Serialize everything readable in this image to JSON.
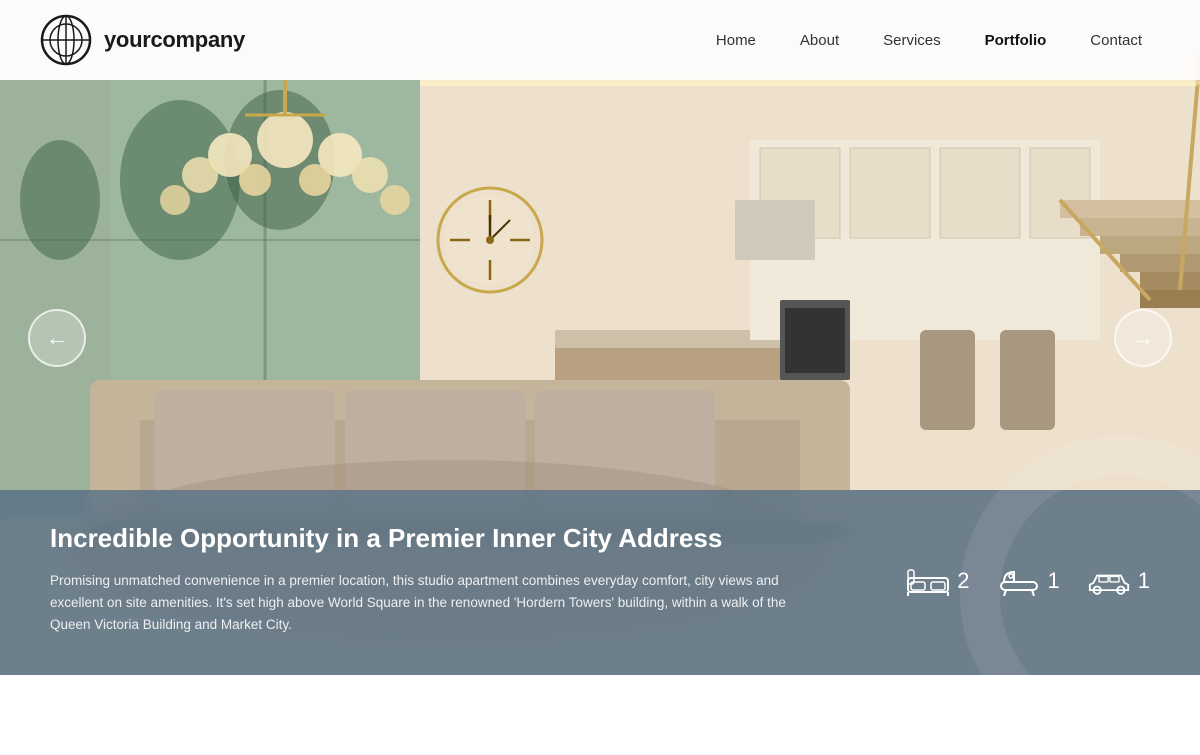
{
  "brand": {
    "name": "yourcompany"
  },
  "nav": {
    "items": [
      {
        "label": "Home",
        "active": false
      },
      {
        "label": "About",
        "active": false
      },
      {
        "label": "Services",
        "active": false
      },
      {
        "label": "Portfolio",
        "active": true
      },
      {
        "label": "Contact",
        "active": false
      }
    ]
  },
  "carousel": {
    "prev_arrow": "←",
    "next_arrow": "→"
  },
  "listing": {
    "title": "Incredible Opportunity in a Premier Inner City Address",
    "description": "Promising unmatched convenience in a premier location, this studio apartment combines everyday comfort, city views and excellent on site amenities. It's set high above World Square in the renowned 'Hordern Towers' building, within a walk of the Queen Victoria Building and Market City.",
    "amenities": [
      {
        "type": "bed",
        "count": "2"
      },
      {
        "type": "bath",
        "count": "1"
      },
      {
        "type": "car",
        "count": "1"
      }
    ]
  },
  "colors": {
    "card_bg": "rgba(90,115,135,0.82)",
    "nav_bg": "rgba(255,255,255,0.92)",
    "accent": "#c8a84b"
  }
}
